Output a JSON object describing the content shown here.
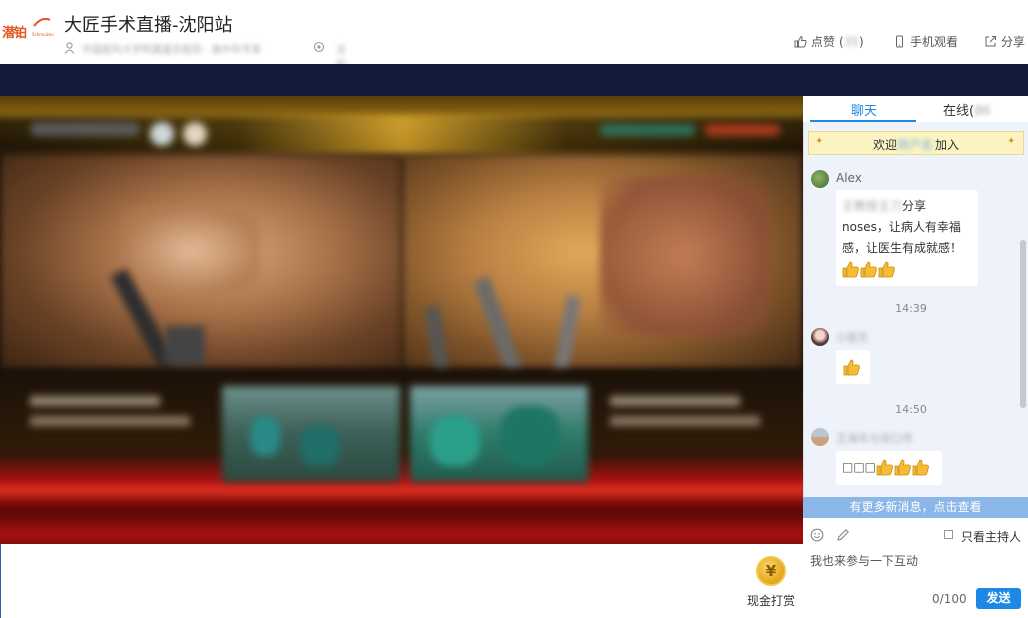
{
  "header": {
    "brand_text": "潜铂",
    "brand_sub": "Schmolzen",
    "title": "大匠手术直播-沈阳站",
    "host_text": "中国医科大学附属盛京医院 · 普外科专家",
    "location_text": "沈阳",
    "like_label": "点赞",
    "like_count": "35",
    "mobile_label": "手机观看",
    "share_label": "分享"
  },
  "tabs": {
    "chat_label": "聊天",
    "online_label_prefix": "在线(",
    "online_count": "86"
  },
  "chat": {
    "welcome_prefix": "欢迎",
    "welcome_name": "用户名",
    "welcome_suffix": "加入",
    "messages": [
      {
        "name": "Alex",
        "text_blurred": "王教授主刀",
        "text": "分享noses，让病人有幸福感，让医生有成就感！"
      },
      {
        "timestamp": "14:39",
        "name": "小医生"
      },
      {
        "timestamp": "14:50",
        "name": "王海东与双口市"
      }
    ],
    "third_text": "□□□",
    "new_msgs_label": "有更多新消息，点击查看"
  },
  "input": {
    "host_only_label": "只看主持人",
    "placeholder": "我也来参与一下互动",
    "counter": "0/100",
    "send_label": "发送"
  },
  "tip": {
    "label": "现金打赏",
    "symbol": "¥"
  },
  "icons": [
    "user-icon",
    "location-icon",
    "thumbs-up-icon",
    "phone-icon",
    "share-icon",
    "emoji-icon",
    "pen-icon",
    "coin-icon"
  ]
}
